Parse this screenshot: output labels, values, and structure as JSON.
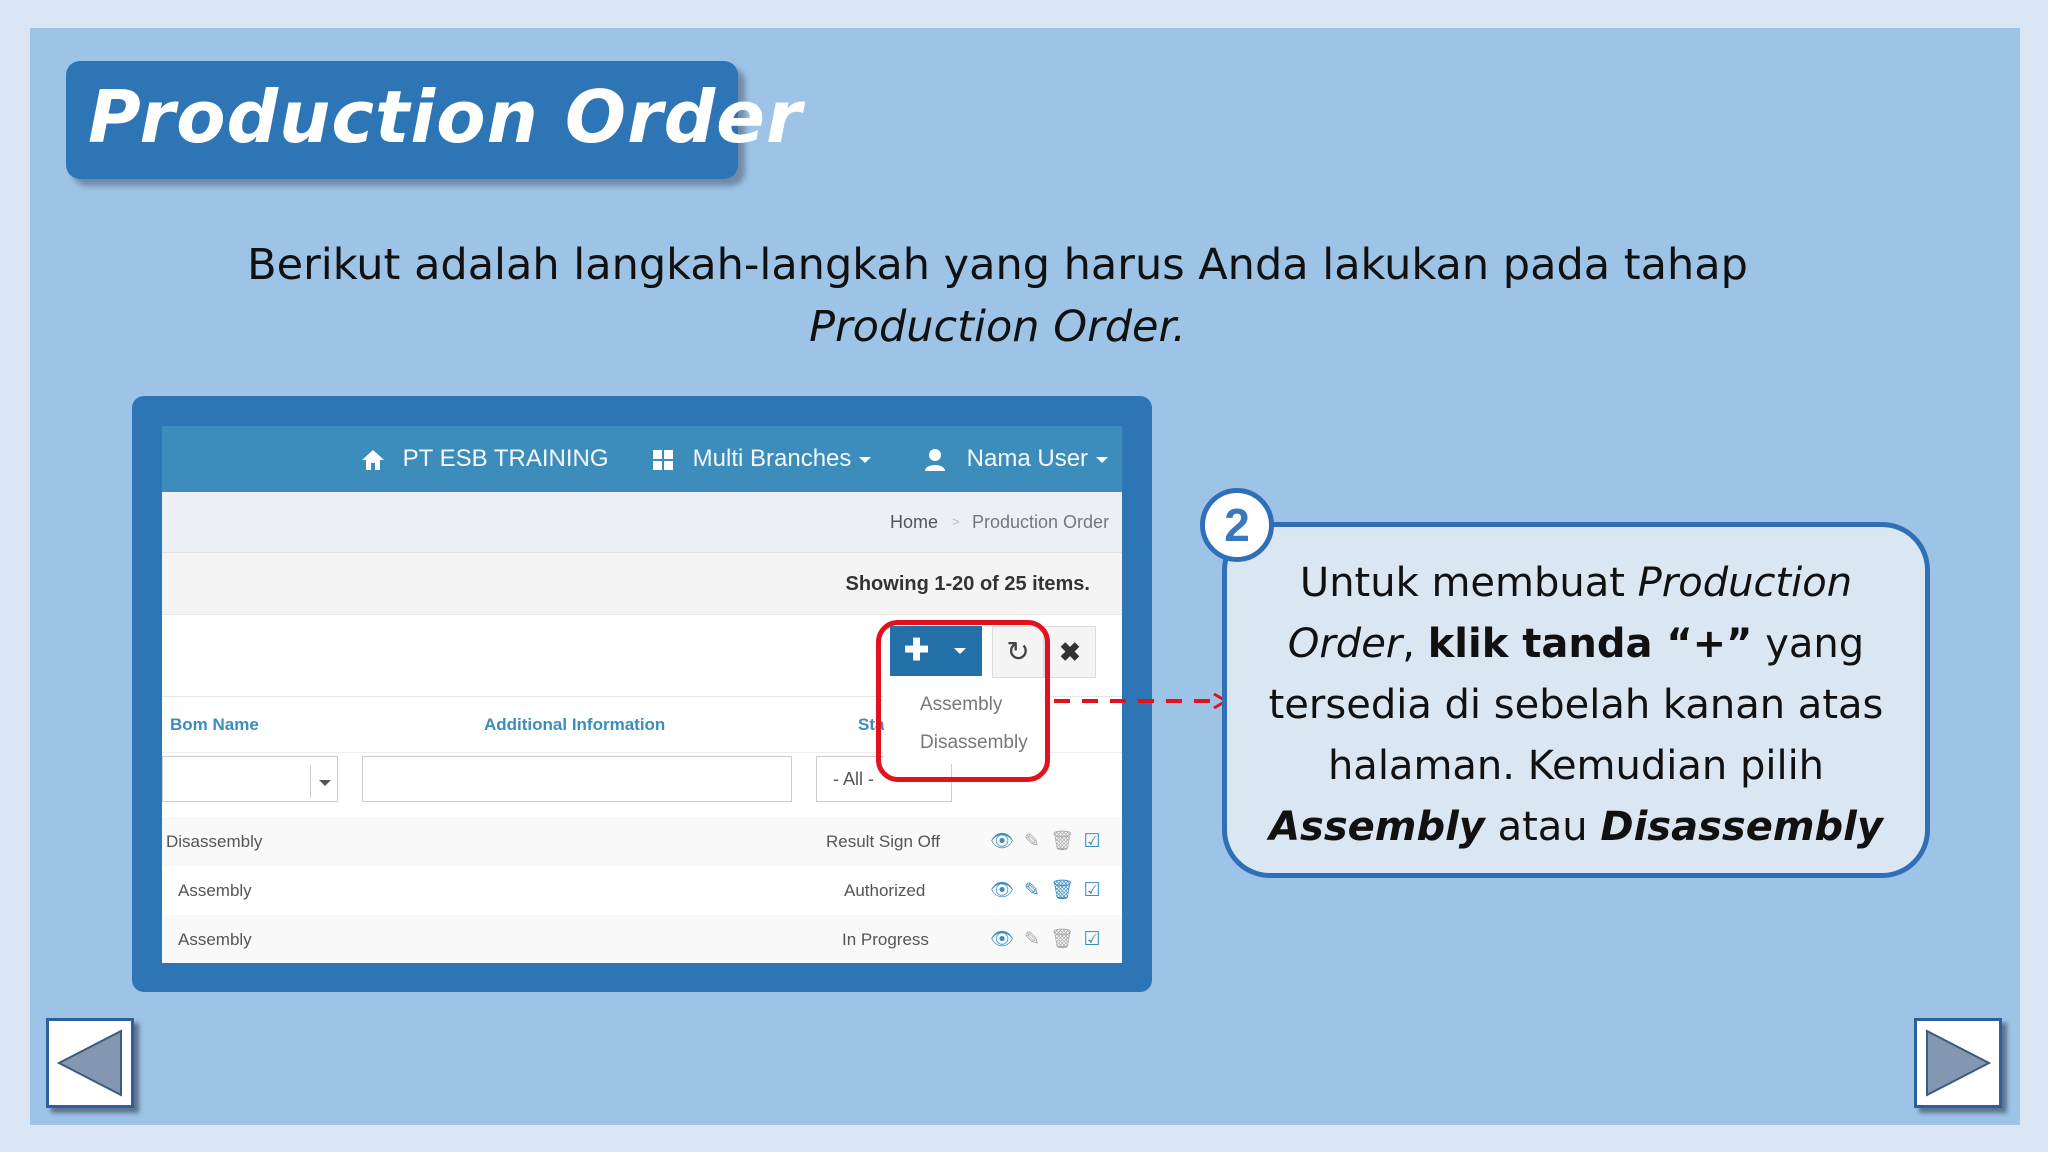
{
  "slide": {
    "title": "Production Order",
    "intro_line1": "Berikut adalah langkah-langkah yang harus Anda lakukan pada tahap",
    "intro_line2": "Production Order."
  },
  "app": {
    "navbar": {
      "company": "PT ESB TRAINING",
      "branches": "Multi Branches",
      "user": "Nama User"
    },
    "breadcrumb": {
      "home": "Home",
      "separator": ">",
      "current": "Production Order"
    },
    "summary": "Showing 1-20 of 25 items.",
    "toolbar": {
      "add_icon": "plus-icon",
      "refresh_icon": "refresh-icon",
      "clear_icon": "close-icon"
    },
    "dropdown_menu": [
      "Assembly",
      "Disassembly"
    ],
    "columns": {
      "bom_name": "Bom Name",
      "additional_information": "Additional Information",
      "status_partial": "Stat"
    },
    "filters": {
      "status_value": "- All -"
    },
    "rows": [
      {
        "bom_name": "Disassembly",
        "status": "Result Sign Off"
      },
      {
        "bom_name": "Assembly",
        "status": "Authorized"
      },
      {
        "bom_name": "Assembly",
        "status": "In Progress"
      }
    ]
  },
  "callout": {
    "step_number": "2",
    "t1": "Untuk membuat ",
    "t2": "Production",
    "t3": "Order",
    "t4": ", ",
    "t5": "klik tanda “+”",
    "t6": " yang",
    "t7": "tersedia di sebelah kanan atas",
    "t8": "halaman. Kemudian pilih",
    "t9": "Assembly",
    "t10": " atau ",
    "t11": "Disassembly"
  },
  "colors": {
    "slide_bg": "#9dc3e6",
    "title_bg": "#2e75b6",
    "navbar": "#3c8dbc",
    "highlight": "#e3101d",
    "callout_border": "#2e6fb8"
  }
}
